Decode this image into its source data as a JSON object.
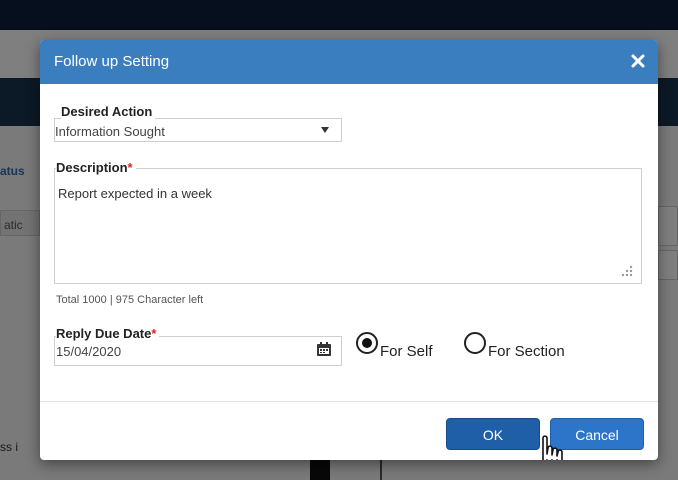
{
  "background": {
    "left_text_1": "atus",
    "left_text_2": "atic",
    "left_text_3": "ss i"
  },
  "modal": {
    "title": "Follow up Setting",
    "close_icon": "close-icon",
    "desired_action": {
      "label": "Desired Action",
      "value": "Information Sought"
    },
    "description": {
      "label": "Description",
      "required_mark": "*",
      "value": "Report expected in a week"
    },
    "char_counter": "Total 1000 | 975 Character left",
    "reply_due_date": {
      "label": "Reply Due Date",
      "required_mark": "*",
      "value": "15/04/2020",
      "icon": "calendar-icon"
    },
    "for_self": {
      "label": "For Self",
      "checked": true
    },
    "for_section": {
      "label": "For Section",
      "checked": false
    },
    "ok_button": "OK",
    "cancel_button": "Cancel"
  },
  "colors": {
    "header": "#3b7ec0",
    "ok_button": "#1f5fa8",
    "cancel_button": "#2c75c8",
    "required": "#d22"
  }
}
